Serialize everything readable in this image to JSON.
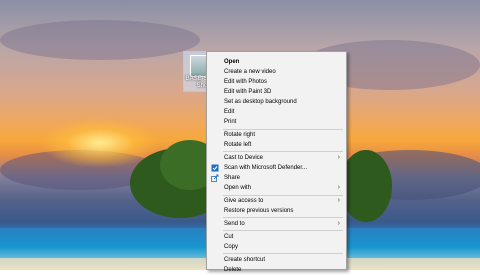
{
  "desktop": {
    "file_icon_label": "BASE-Sw... -Shor"
  },
  "context_menu": {
    "open": "Open",
    "create_video": "Create a new video",
    "edit_photos": "Edit with Photos",
    "edit_paint3d": "Edit with Paint 3D",
    "set_background": "Set as desktop background",
    "edit": "Edit",
    "print": "Print",
    "rotate_right": "Rotate right",
    "rotate_left": "Rotate left",
    "cast": "Cast to Device",
    "scan": "Scan with Microsoft Defender...",
    "share": "Share",
    "open_with": "Open with",
    "give_access": "Give access to",
    "restore": "Restore previous versions",
    "send_to": "Send to",
    "cut": "Cut",
    "copy": "Copy",
    "create_shortcut": "Create shortcut",
    "delete": "Delete"
  },
  "icons": {
    "scan": "defender-shield-icon",
    "share": "share-icon",
    "submenu": "chevron-right-icon"
  }
}
